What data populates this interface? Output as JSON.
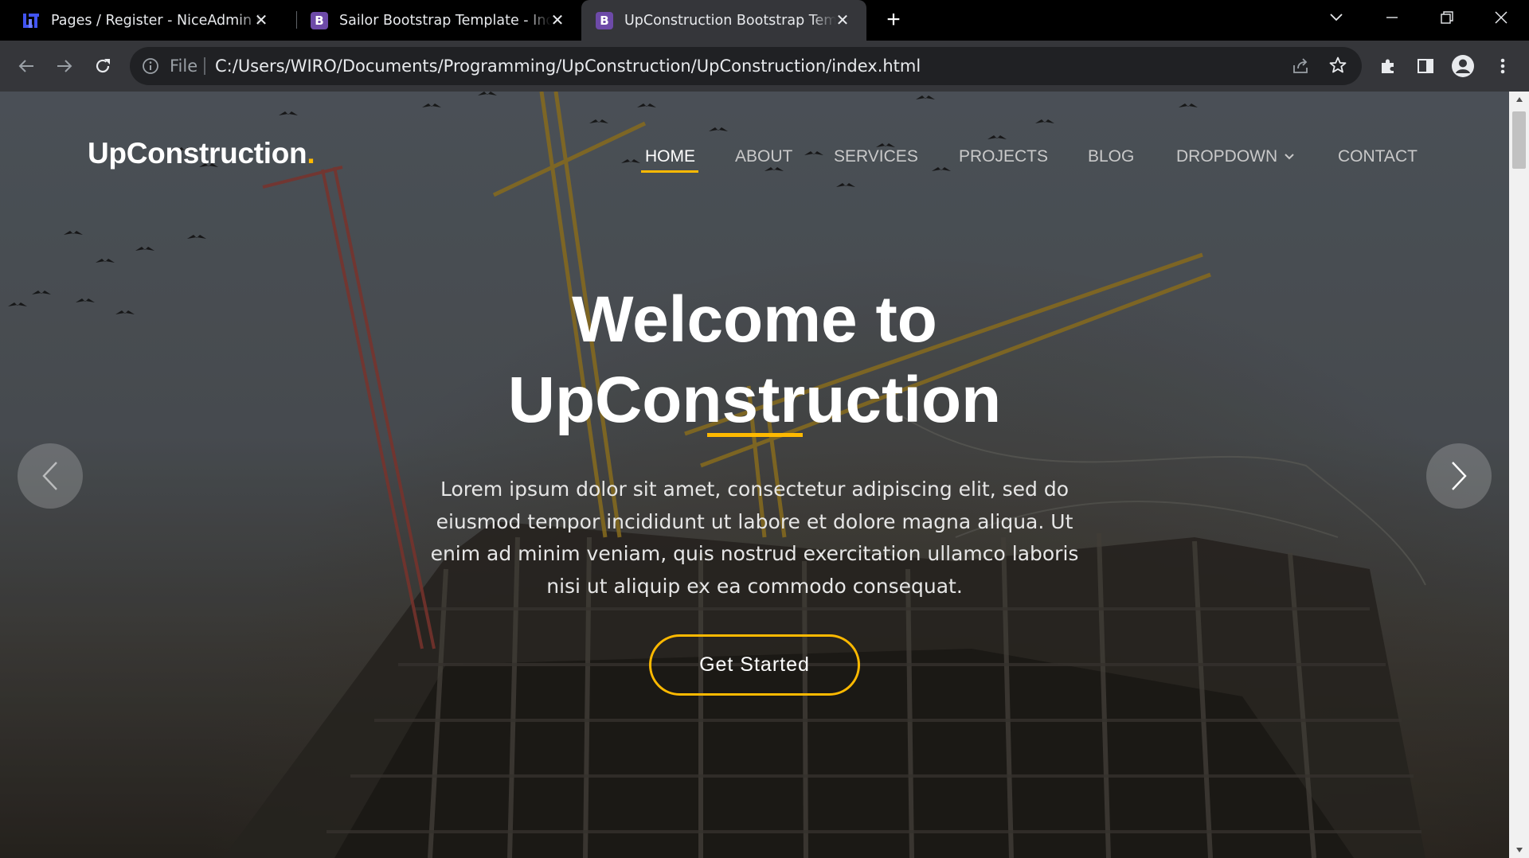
{
  "browser": {
    "tabs": [
      {
        "title": "Pages / Register - NiceAdmin Bootstrap Template",
        "favicon": "niceadmin-favicon-icon",
        "active": false
      },
      {
        "title": "Sailor Bootstrap Template - Index",
        "favicon": "bootstrap-favicon-icon",
        "favicon_letter": "B",
        "active": false
      },
      {
        "title": "UpConstruction Bootstrap Template - Index",
        "favicon": "bootstrap-favicon-icon",
        "favicon_letter": "B",
        "active": true
      }
    ],
    "address": {
      "scheme_label": "File",
      "url": "C:/Users/WIRO/Documents/Programming/UpConstruction/UpConstruction/index.html"
    }
  },
  "site": {
    "logo_text": "UpConstruction",
    "logo_dot": ".",
    "nav": [
      {
        "label": "HOME",
        "active": true
      },
      {
        "label": "ABOUT"
      },
      {
        "label": "SERVICES"
      },
      {
        "label": "PROJECTS"
      },
      {
        "label": "BLOG"
      },
      {
        "label": "DROPDOWN",
        "has_chevron": true
      },
      {
        "label": "CONTACT"
      }
    ],
    "hero": {
      "title_line1": "Welcome to",
      "title_line2": "UpConstruction",
      "lead": "Lorem ipsum dolor sit amet, consectetur adipiscing elit, sed do eiusmod tempor incididunt ut labore et dolore magna aliqua. Ut enim ad minim veniam, quis nostrud exercitation ullamco laboris nisi ut aliquip ex ea commodo consequat.",
      "cta_label": "Get Started"
    }
  },
  "colors": {
    "accent": "#feb900",
    "chrome_dark": "#000000",
    "chrome_toolbar": "#35363a",
    "omnibox": "#202124"
  }
}
